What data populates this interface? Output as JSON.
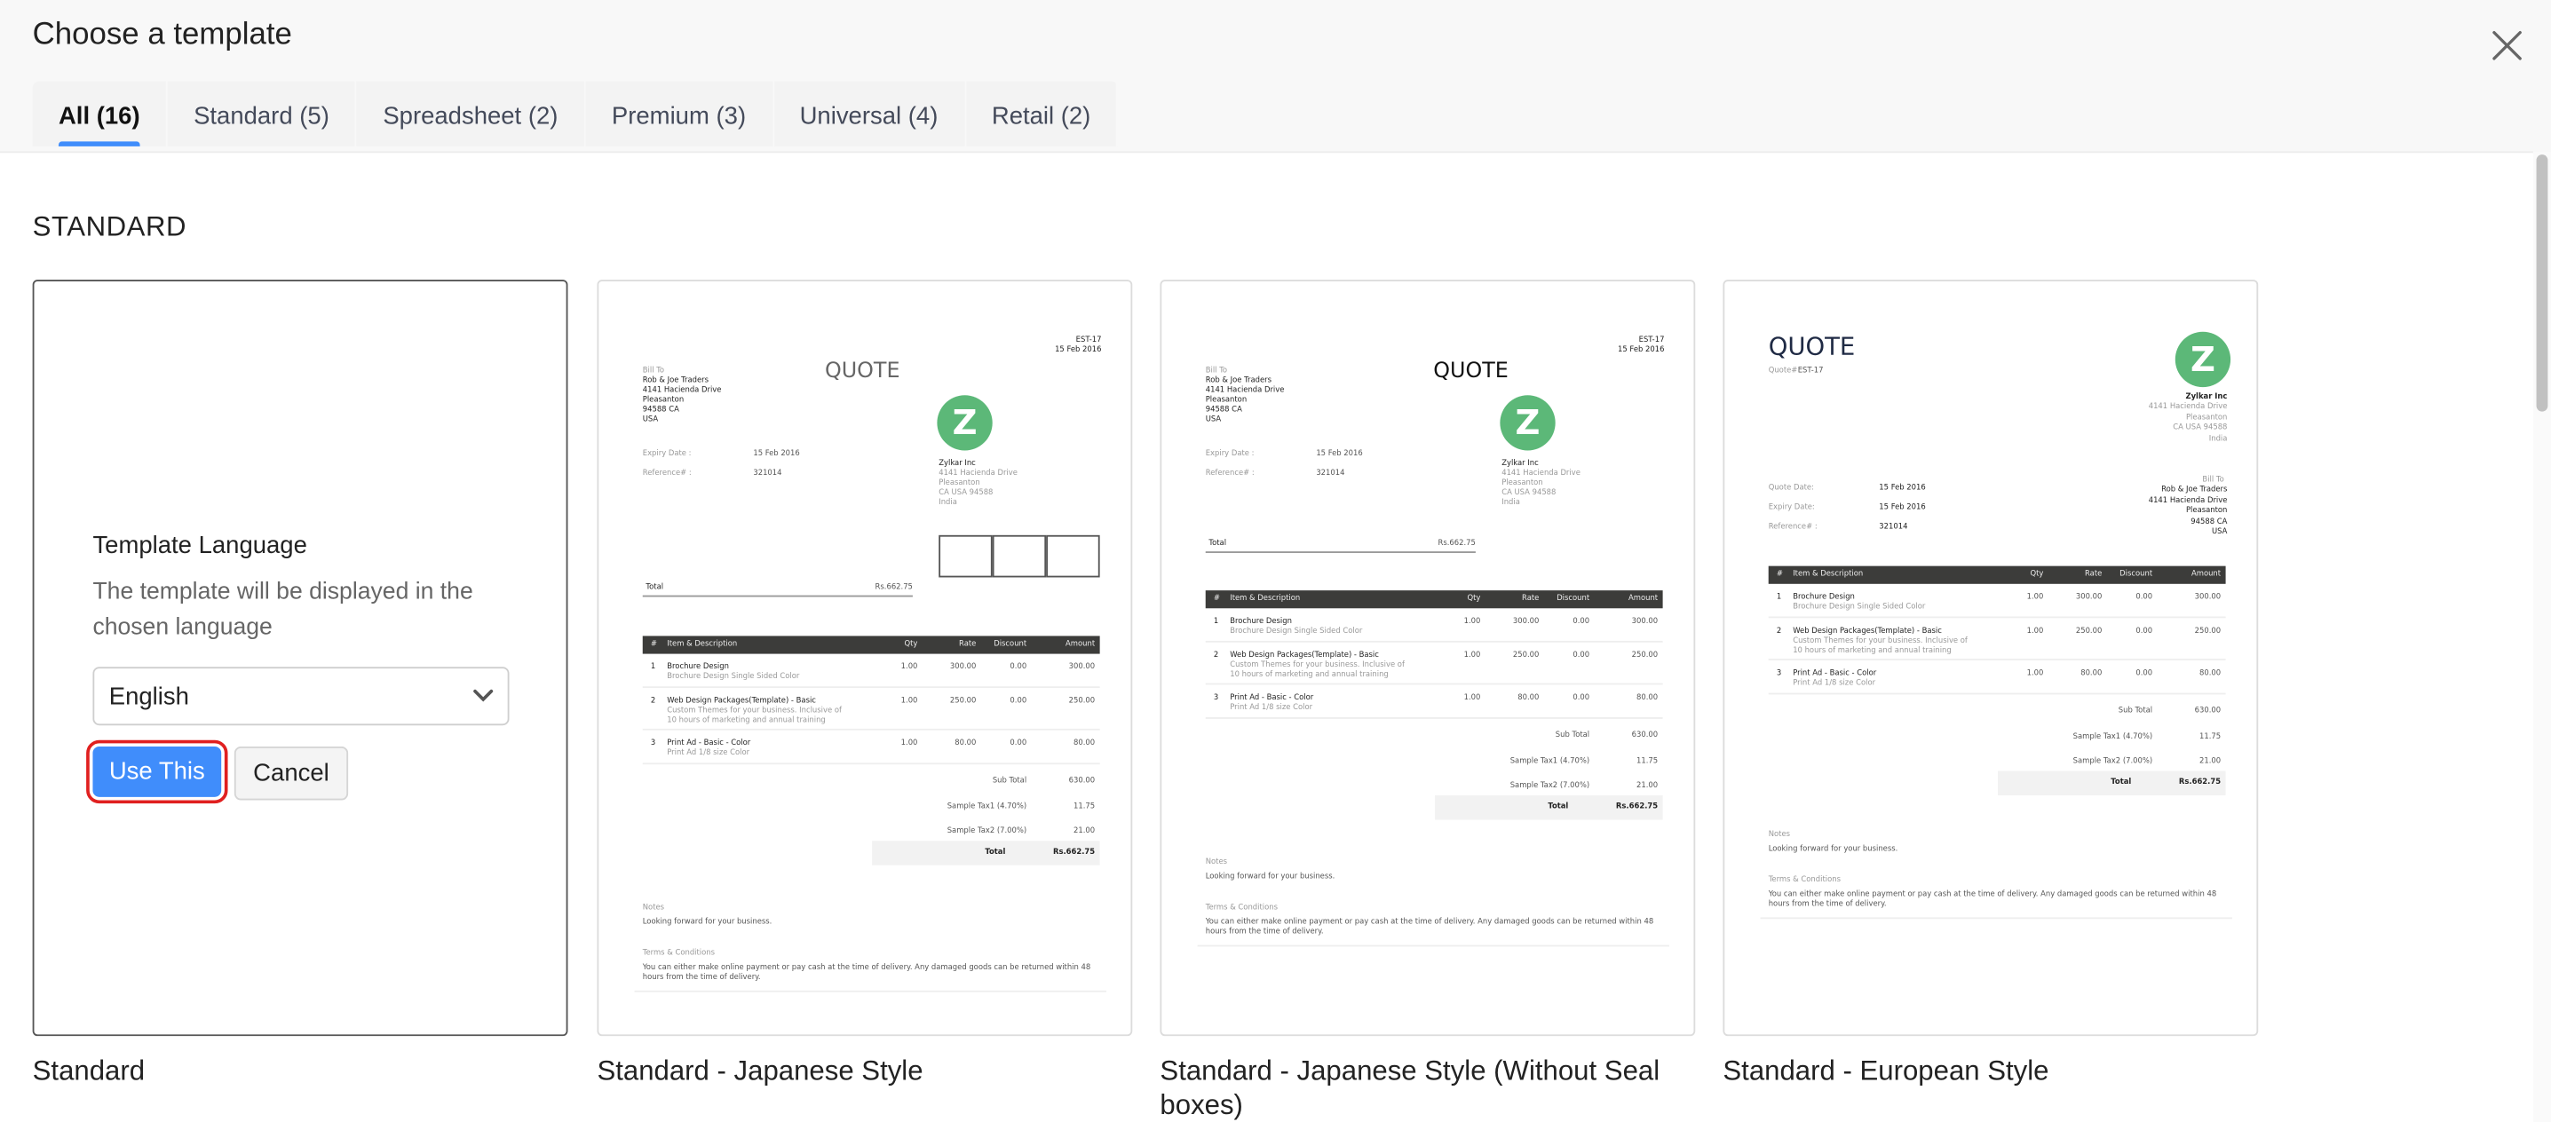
{
  "header": {
    "title": "Choose a template",
    "close_icon": "close-x-icon"
  },
  "tabs": [
    {
      "label": "All (16)",
      "active": true
    },
    {
      "label": "Standard (5)"
    },
    {
      "label": "Spreadsheet (2)"
    },
    {
      "label": "Premium (3)"
    },
    {
      "label": "Universal (4)"
    },
    {
      "label": "Retail (2)"
    }
  ],
  "section_title": "STANDARD",
  "colors": {
    "accent": "#408dfb",
    "logo": "#5cb878",
    "highlight": "#e02020"
  },
  "selected_card": {
    "language_title": "Template Language",
    "language_desc": "The template will be displayed in the chosen language",
    "language_value": "English",
    "use_label": "Use This",
    "cancel_label": "Cancel"
  },
  "templates": [
    {
      "name": "Standard"
    },
    {
      "name": "Standard - Japanese Style"
    },
    {
      "name": "Standard - Japanese Style (Without Seal boxes)"
    },
    {
      "name": "Standard - European Style"
    }
  ],
  "invoice": {
    "number": "EST-17",
    "date": "15 Feb 2016",
    "title": "QUOTE",
    "quote_no_label": "Quote#",
    "bill_to_label": "Bill To",
    "bill_to": [
      "Rob & Joe Traders",
      "4141 Hacienda Drive",
      "Pleasanton",
      "94588 CA",
      "USA"
    ],
    "quote_date_label": "Quote Date:",
    "expiry_label": "Expiry Date :",
    "expiry_label_eu": "Expiry Date:",
    "expiry": "15 Feb 2016",
    "ref_label": "Reference# :",
    "ref": "321014",
    "logo_letter": "Z",
    "company": "Zylkar Inc",
    "company_address": [
      "4141 Hacienda Drive",
      "Pleasanton",
      "CA USA 94588",
      "India"
    ],
    "total_label": "Total",
    "total": "Rs.662.75",
    "columns": [
      "#",
      "Item & Description",
      "Qty",
      "Rate",
      "Discount",
      "Amount"
    ],
    "items": [
      {
        "n": "1",
        "name": "Brochure Design",
        "desc": "Brochure Design Single Sided Color",
        "qty": "1.00",
        "rate": "300.00",
        "discount": "0.00",
        "amount": "300.00"
      },
      {
        "n": "2",
        "name": "Web Design Packages(Template) - Basic",
        "desc": "Custom Themes for your business. Inclusive of 10 hours of marketing and annual training",
        "qty": "1.00",
        "rate": "250.00",
        "discount": "0.00",
        "amount": "250.00"
      },
      {
        "n": "3",
        "name": "Print Ad - Basic - Color",
        "desc": "Print Ad 1/8 size Color",
        "qty": "1.00",
        "rate": "80.00",
        "discount": "0.00",
        "amount": "80.00"
      }
    ],
    "sub_total_label": "Sub Total",
    "sub_total": "630.00",
    "tax1_label": "Sample Tax1 (4.70%)",
    "tax1": "11.75",
    "tax2_label": "Sample Tax2 (7.00%)",
    "tax2": "21.00",
    "notes_label": "Notes",
    "notes": "Looking forward for your business.",
    "terms_label": "Terms & Conditions",
    "terms": "You can either make online payment or pay cash at the time of delivery. Any damaged goods can be returned within 48 hours from the time of delivery."
  }
}
